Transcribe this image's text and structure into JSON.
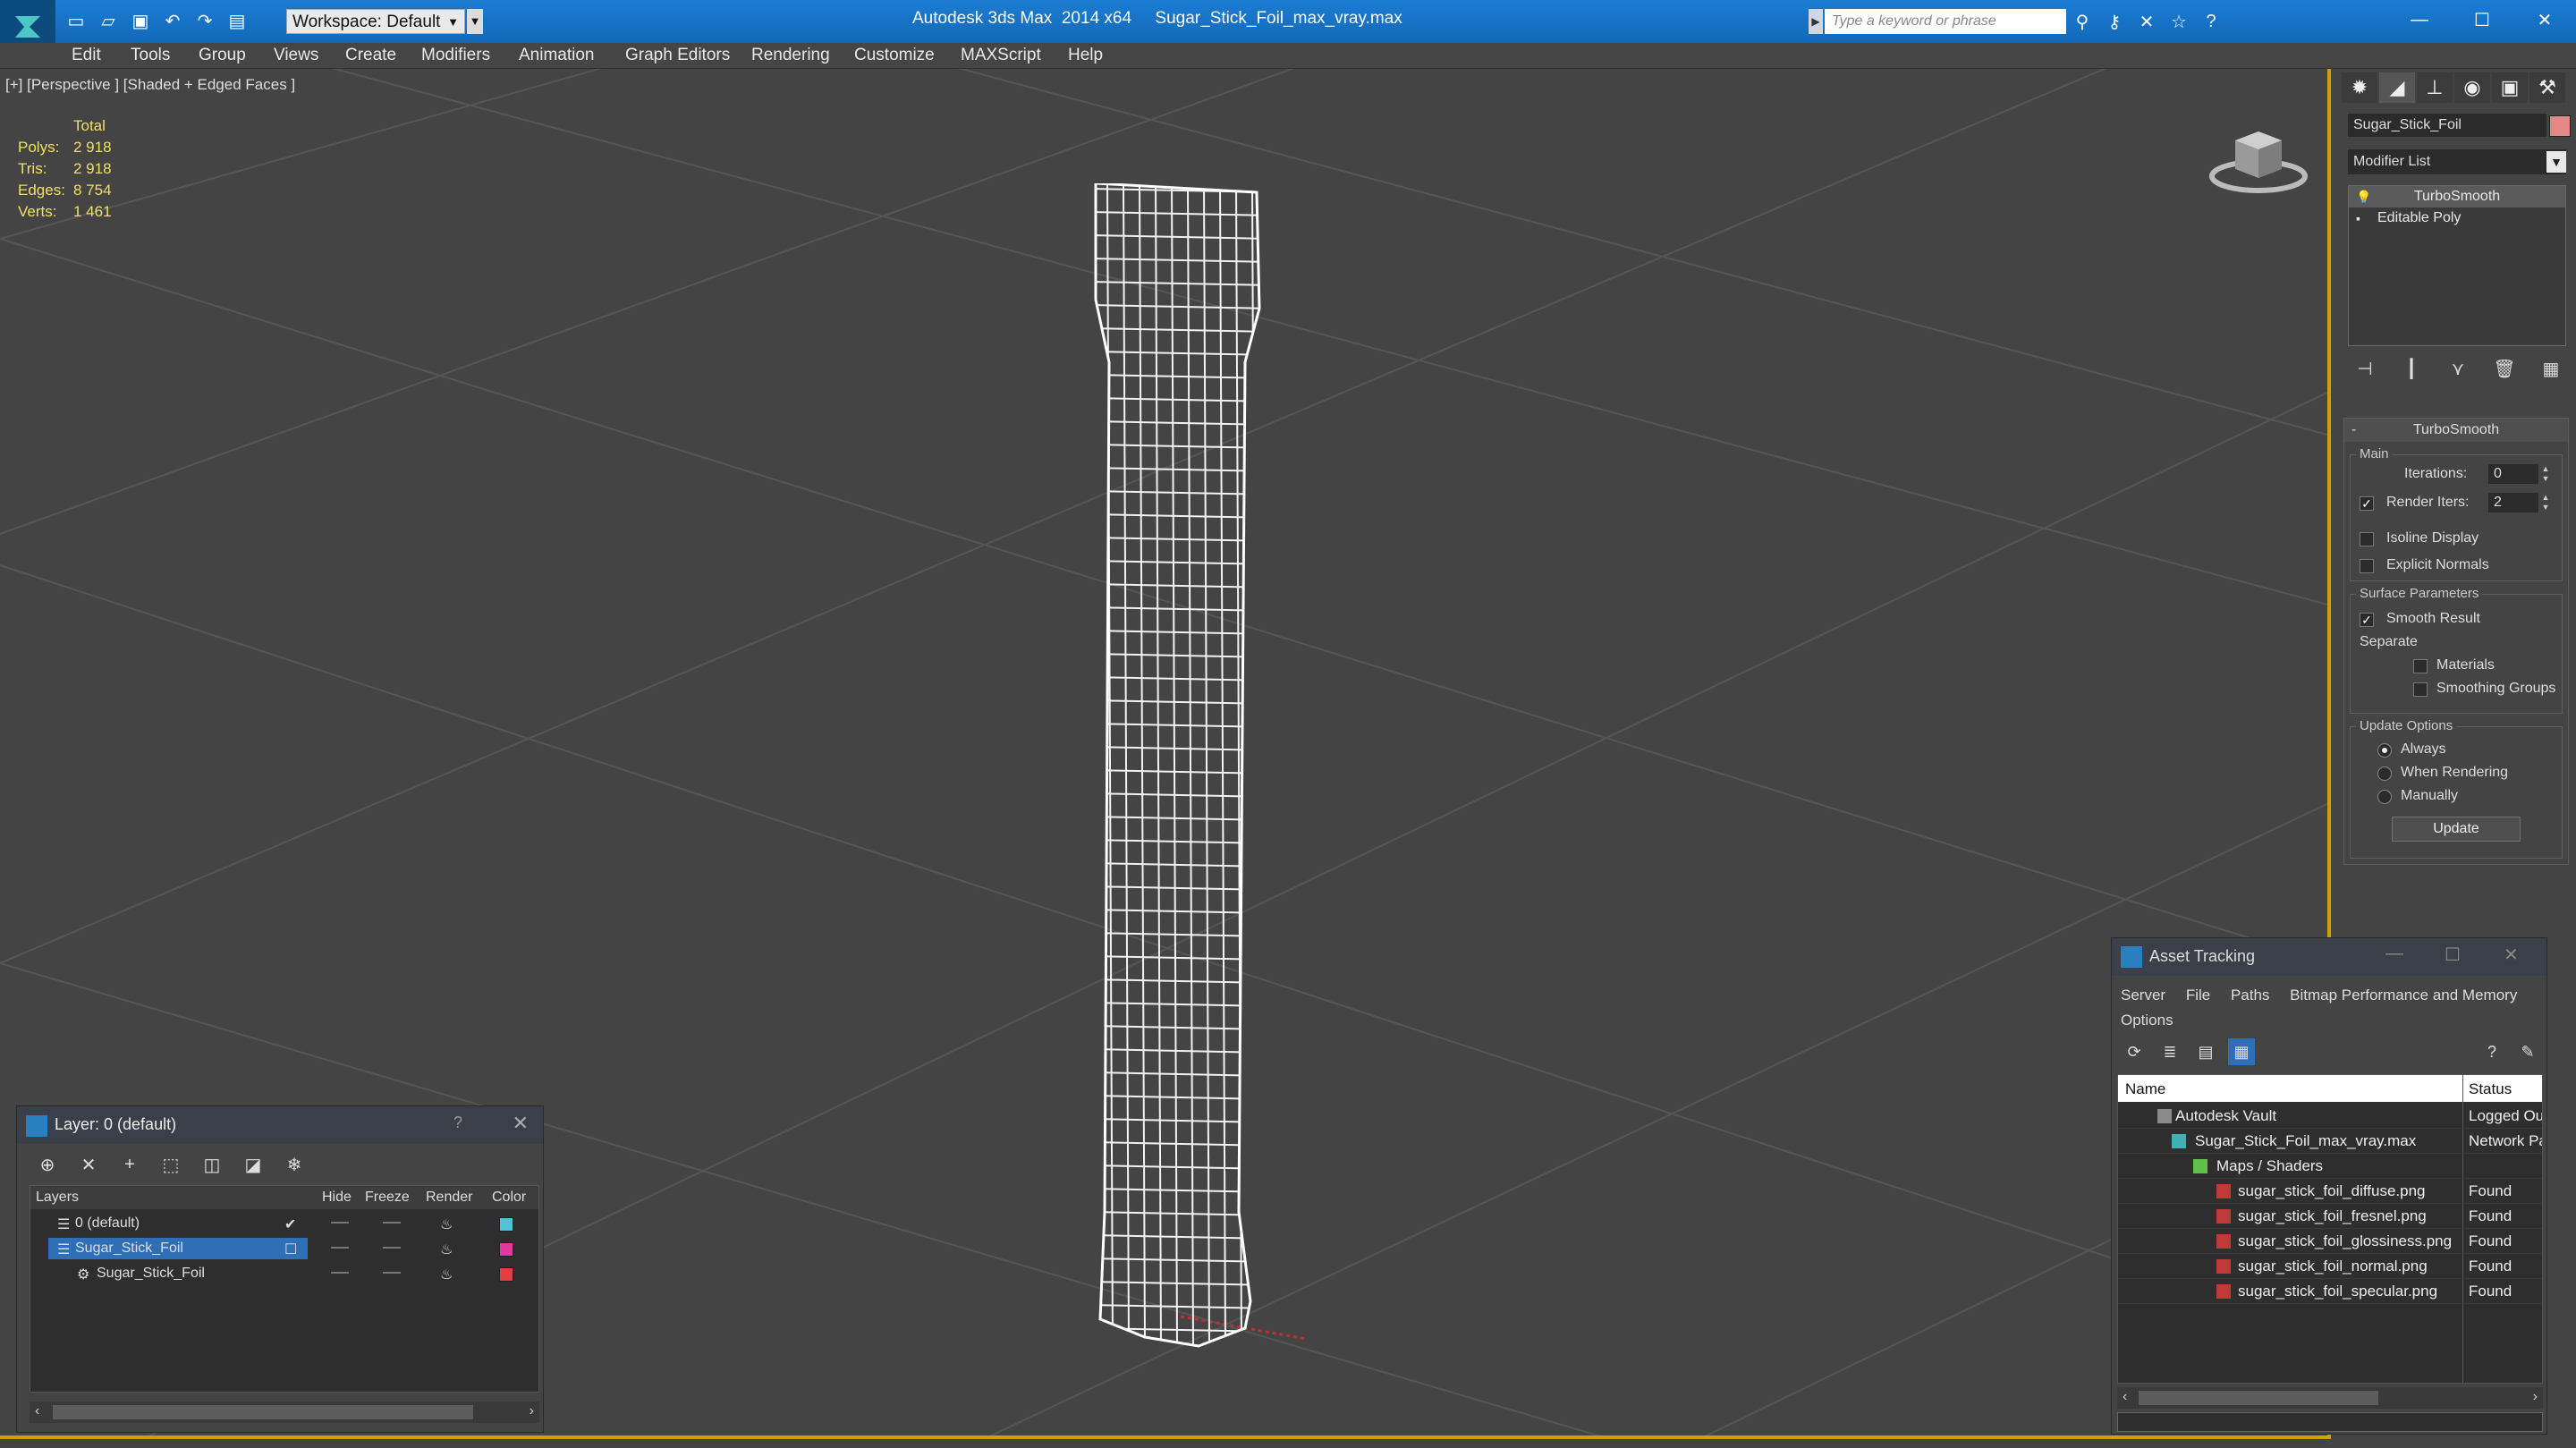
{
  "app": {
    "title": "Autodesk 3ds Max  2014 x64     Sugar_Stick_Foil_max_vray.max",
    "workspace": "Workspace: Default",
    "search_placeholder": "Type a keyword or phrase"
  },
  "menu": [
    "Edit",
    "Tools",
    "Group",
    "Views",
    "Create",
    "Modifiers",
    "Animation",
    "Graph Editors",
    "Rendering",
    "Customize",
    "MAXScript",
    "Help"
  ],
  "viewport": {
    "label": "[+] [Perspective ] [Shaded + Edged Faces ]",
    "stats": {
      "header": "Total",
      "rows": [
        {
          "label": "Polys:",
          "value": "2 918"
        },
        {
          "label": "Tris:",
          "value": "2 918"
        },
        {
          "label": "Edges:",
          "value": "8 754"
        },
        {
          "label": "Verts:",
          "value": "1 461"
        }
      ]
    }
  },
  "command_panel": {
    "object_name": "Sugar_Stick_Foil",
    "object_color": "#e38787",
    "modifier_list": "Modifier List",
    "stack": [
      {
        "label": "TurboSmooth",
        "selected": true
      },
      {
        "label": "Editable Poly",
        "selected": false
      }
    ],
    "rollout_title": "TurboSmooth",
    "main_group": "Main",
    "iterations_label": "Iterations:",
    "iterations_value": "0",
    "render_iters_label": "Render Iters:",
    "render_iters_value": "2",
    "render_iters_checked": true,
    "isoline_label": "Isoline Display",
    "explicit_normals_label": "Explicit Normals",
    "surface_group": "Surface Parameters",
    "smooth_result_label": "Smooth Result",
    "separate_label": "Separate",
    "materials_label": "Materials",
    "smoothing_groups_label": "Smoothing Groups",
    "update_group": "Update Options",
    "always_label": "Always",
    "when_rendering_label": "When Rendering",
    "manually_label": "Manually",
    "update_button": "Update"
  },
  "layer_window": {
    "title": "Layer: 0 (default)",
    "help": "?",
    "columns": {
      "layers": "Layers",
      "hide": "Hide",
      "freeze": "Freeze",
      "render": "Render",
      "color": "Color"
    },
    "rows": [
      {
        "name": "0 (default)",
        "color": "#4ec3d9",
        "selected": false
      },
      {
        "name": "Sugar_Stick_Foil",
        "color": "#e03aa0",
        "selected": true
      },
      {
        "name": "Sugar_Stick_Foil",
        "color": "#e04040",
        "selected": false
      }
    ]
  },
  "asset_window": {
    "title": "Asset Tracking",
    "menu": [
      "Server",
      "File",
      "Paths",
      "Bitmap Performance and Memory",
      "Options"
    ],
    "columns": {
      "name": "Name",
      "status": "Status"
    },
    "rows": [
      {
        "name": "Autodesk Vault",
        "status": "Logged Ou",
        "icon": "vault-icon"
      },
      {
        "name": "Sugar_Stick_Foil_max_vray.max",
        "status": "Network Pa",
        "icon": "max-file-icon"
      },
      {
        "name": "Maps / Shaders",
        "status": "",
        "icon": "maps-folder-icon"
      },
      {
        "name": "sugar_stick_foil_diffuse.png",
        "status": "Found",
        "icon": "png-icon"
      },
      {
        "name": "sugar_stick_foil_fresnel.png",
        "status": "Found",
        "icon": "png-icon"
      },
      {
        "name": "sugar_stick_foil_glossiness.png",
        "status": "Found",
        "icon": "png-icon"
      },
      {
        "name": "sugar_stick_foil_normal.png",
        "status": "Found",
        "icon": "png-icon"
      },
      {
        "name": "sugar_stick_foil_specular.png",
        "status": "Found",
        "icon": "png-icon"
      }
    ]
  }
}
